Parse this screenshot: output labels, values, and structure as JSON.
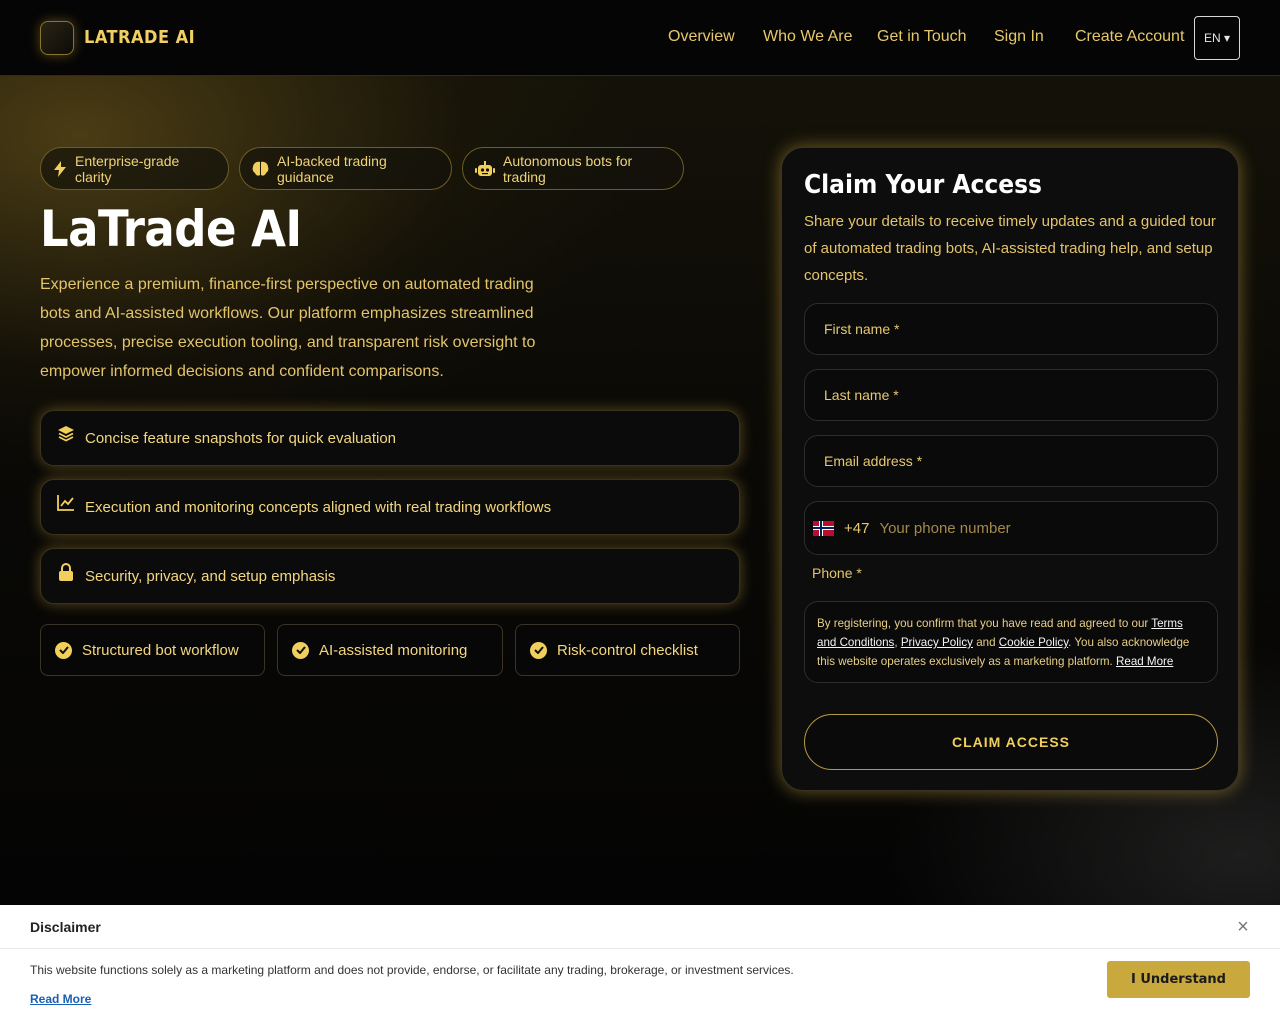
{
  "brand": {
    "name": "LATRADE AI"
  },
  "nav": {
    "items": [
      "Overview",
      "Who We Are",
      "Get in Touch",
      "Sign In",
      "Create Account"
    ],
    "language": "EN ▾"
  },
  "badges": [
    {
      "icon": "lightning-icon",
      "label": "Enterprise-grade clarity"
    },
    {
      "icon": "brain-icon",
      "label": "AI-backed trading guidance"
    },
    {
      "icon": "robot-icon",
      "label": "Autonomous bots for trading"
    }
  ],
  "hero": {
    "title": "LaTrade AI",
    "description": "Experience a premium, finance-first perspective on automated trading bots and AI-assisted workflows. Our platform emphasizes streamlined processes, precise execution tooling, and transparent risk oversight to empower informed decisions and confident comparisons."
  },
  "features": [
    {
      "icon": "layers-icon",
      "label": "Concise feature snapshots for quick evaluation"
    },
    {
      "icon": "chart-line-icon",
      "label": "Execution and monitoring concepts aligned with real trading workflows"
    },
    {
      "icon": "lock-icon",
      "label": "Security, privacy, and setup emphasis"
    }
  ],
  "checklist": [
    {
      "icon": "check-circle-icon",
      "label": "Structured bot workflow"
    },
    {
      "icon": "check-circle-icon",
      "label": "AI-assisted monitoring"
    },
    {
      "icon": "check-circle-icon",
      "label": "Risk-control checklist"
    }
  ],
  "form": {
    "title": "Claim Your Access",
    "description": "Share your details to receive timely updates and a guided tour of automated trading bots, AI-assisted trading help, and setup concepts.",
    "first_name": "First name *",
    "last_name": "Last name *",
    "email": "Email address *",
    "phone_code": "+47",
    "phone_placeholder": "Your phone number",
    "phone_label": "Phone *",
    "consent": {
      "pre": "By registering, you confirm that you have read and agreed to our ",
      "terms": "Terms and Conditions",
      "comma": ", ",
      "privacy": "Privacy Policy",
      "and": " and ",
      "cookie": "Cookie Policy",
      "post": ". You also acknowledge this website operates exclusively as a marketing platform. ",
      "read_more": "Read More"
    },
    "submit": "CLAIM ACCESS"
  },
  "disclaimer": {
    "title": "Disclaimer",
    "close": "×",
    "text": "This website functions solely as a marketing platform and does not provide, endorse, or facilitate any trading, brokerage, or investment services.",
    "read_more": "Read More",
    "button": "I Understand"
  },
  "colors": {
    "accent": "#f0cf5c",
    "text_gold": "#e3c46b",
    "background": "#050505",
    "disclaimer_button": "#c9a83e"
  }
}
